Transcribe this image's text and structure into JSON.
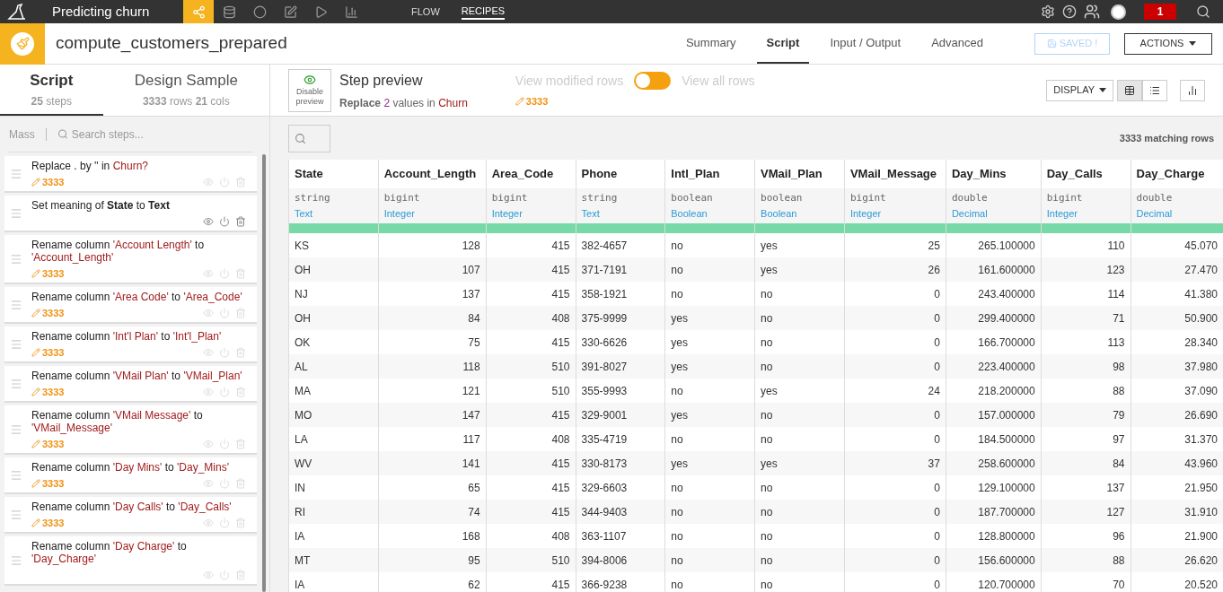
{
  "topbar": {
    "project": "Predicting churn",
    "nav_icons": [
      {
        "kind": "flow",
        "selected": true
      },
      {
        "kind": "datasets",
        "selected": false
      },
      {
        "kind": "recipes",
        "selected": false
      },
      {
        "kind": "notebooks",
        "selected": false
      },
      {
        "kind": "jobs",
        "selected": false
      },
      {
        "kind": "dashboards",
        "selected": false
      }
    ],
    "links": [
      {
        "label": "FLOW",
        "selected": false
      },
      {
        "label": "RECIPES",
        "selected": true
      }
    ],
    "notification_count": "1"
  },
  "recipe": {
    "name": "compute_customers_prepared",
    "tabs": [
      {
        "label": "Summary",
        "selected": false
      },
      {
        "label": "Script",
        "selected": true
      },
      {
        "label": "Input / Output",
        "selected": false
      },
      {
        "label": "Advanced",
        "selected": false
      }
    ],
    "saved_label": "SAVED !",
    "actions_label": "ACTIONS"
  },
  "left_tabs": [
    {
      "title": "Script",
      "selected": true,
      "sub": [
        {
          "text": "25",
          "bold": true
        },
        {
          "text": "steps",
          "bold": false
        }
      ]
    },
    {
      "title": "Design Sample",
      "selected": false,
      "sub": [
        {
          "text": "3333",
          "bold": true
        },
        {
          "text": "rows",
          "bold": false
        },
        {
          "text": "21",
          "bold": true
        },
        {
          "text": "cols",
          "bold": false
        }
      ]
    }
  ],
  "mass_label": "Mass",
  "search": {
    "placeholder": "Search steps..."
  },
  "steps": [
    {
      "parts": [
        {
          "t": "Replace . by '' in",
          "kind": "plain"
        },
        {
          "t": "Churn?",
          "kind": "column"
        }
      ],
      "count": "3333",
      "enabled": false
    },
    {
      "parts": [
        {
          "t": "Set meaning of",
          "kind": "plain"
        },
        {
          "t": "State",
          "kind": "bold"
        },
        {
          "t": "to",
          "kind": "plain"
        },
        {
          "t": "Text",
          "kind": "bold"
        }
      ],
      "enabled": true
    },
    {
      "parts": [
        {
          "t": "Rename column",
          "kind": "plain"
        },
        {
          "t": "'Account Length'",
          "kind": "column"
        },
        {
          "t": "to",
          "kind": "plain"
        },
        {
          "t": "'Account_Length'",
          "kind": "column"
        }
      ],
      "count": "3333",
      "enabled": false
    },
    {
      "parts": [
        {
          "t": "Rename column",
          "kind": "plain"
        },
        {
          "t": "'Area Code'",
          "kind": "column"
        },
        {
          "t": "to",
          "kind": "plain"
        },
        {
          "t": "'Area_Code'",
          "kind": "column"
        }
      ],
      "count": "3333",
      "enabled": false
    },
    {
      "parts": [
        {
          "t": "Rename column",
          "kind": "plain"
        },
        {
          "t": "'Int'l Plan'",
          "kind": "column"
        },
        {
          "t": "to",
          "kind": "plain"
        },
        {
          "t": "'Int'l_Plan'",
          "kind": "column"
        }
      ],
      "count": "3333",
      "enabled": false
    },
    {
      "parts": [
        {
          "t": "Rename column",
          "kind": "plain"
        },
        {
          "t": "'VMail Plan'",
          "kind": "column"
        },
        {
          "t": "to",
          "kind": "plain"
        },
        {
          "t": "'VMail_Plan'",
          "kind": "column"
        }
      ],
      "count": "3333",
      "enabled": false
    },
    {
      "parts": [
        {
          "t": "Rename column",
          "kind": "plain"
        },
        {
          "t": "'VMail Message'",
          "kind": "column"
        },
        {
          "t": "to",
          "kind": "plain"
        },
        {
          "t": "'VMail_Message'",
          "kind": "column"
        }
      ],
      "count": "3333",
      "enabled": false
    },
    {
      "parts": [
        {
          "t": "Rename column",
          "kind": "plain"
        },
        {
          "t": "'Day Mins'",
          "kind": "column"
        },
        {
          "t": "to",
          "kind": "plain"
        },
        {
          "t": "'Day_Mins'",
          "kind": "column"
        }
      ],
      "count": "3333",
      "enabled": false
    },
    {
      "parts": [
        {
          "t": "Rename column",
          "kind": "plain"
        },
        {
          "t": "'Day Calls'",
          "kind": "column"
        },
        {
          "t": "to",
          "kind": "plain"
        },
        {
          "t": "'Day_Calls'",
          "kind": "column"
        }
      ],
      "count": "3333",
      "enabled": false
    },
    {
      "parts": [
        {
          "t": "Rename column",
          "kind": "plain"
        },
        {
          "t": "'Day Charge'",
          "kind": "column"
        },
        {
          "t": "to",
          "kind": "plain"
        },
        {
          "t": "'Day_Charge'",
          "kind": "column"
        }
      ]
    }
  ],
  "preview": {
    "disable_label": "Disable preview",
    "title": "Step preview",
    "summary": [
      {
        "t": "Replace",
        "kind": "bold"
      },
      {
        "t": "2",
        "kind": "number"
      },
      {
        "t": "values in",
        "kind": "plain"
      },
      {
        "t": "Churn",
        "kind": "column"
      }
    ],
    "count": "3333",
    "view_modified": "View modified rows",
    "view_all": "View all rows",
    "show_all": false,
    "display_label": "DISPLAY",
    "views": [
      {
        "kind": "table",
        "selected": true
      },
      {
        "kind": "list",
        "selected": false
      }
    ]
  },
  "matching": "3333 matching rows",
  "table": {
    "columns": [
      {
        "name": "State",
        "storage": "string",
        "meaning": "Text",
        "kind": "text"
      },
      {
        "name": "Account_Length",
        "storage": "bigint",
        "meaning": "Integer",
        "kind": "number"
      },
      {
        "name": "Area_Code",
        "storage": "bigint",
        "meaning": "Integer",
        "kind": "number"
      },
      {
        "name": "Phone",
        "storage": "string",
        "meaning": "Text",
        "kind": "text"
      },
      {
        "name": "Intl_Plan",
        "storage": "boolean",
        "meaning": "Boolean",
        "kind": "text"
      },
      {
        "name": "VMail_Plan",
        "storage": "boolean",
        "meaning": "Boolean",
        "kind": "text"
      },
      {
        "name": "VMail_Message",
        "storage": "bigint",
        "meaning": "Integer",
        "kind": "number"
      },
      {
        "name": "Day_Mins",
        "storage": "double",
        "meaning": "Decimal",
        "kind": "number"
      },
      {
        "name": "Day_Calls",
        "storage": "bigint",
        "meaning": "Integer",
        "kind": "number"
      },
      {
        "name": "Day_Charge",
        "storage": "double",
        "meaning": "Decimal",
        "kind": "number"
      }
    ],
    "rows": [
      [
        "KS",
        "128",
        "415",
        "382-4657",
        "no",
        "yes",
        "25",
        "265.100000",
        "110",
        "45.070"
      ],
      [
        "OH",
        "107",
        "415",
        "371-7191",
        "no",
        "yes",
        "26",
        "161.600000",
        "123",
        "27.470"
      ],
      [
        "NJ",
        "137",
        "415",
        "358-1921",
        "no",
        "no",
        "0",
        "243.400000",
        "114",
        "41.380"
      ],
      [
        "OH",
        "84",
        "408",
        "375-9999",
        "yes",
        "no",
        "0",
        "299.400000",
        "71",
        "50.900"
      ],
      [
        "OK",
        "75",
        "415",
        "330-6626",
        "yes",
        "no",
        "0",
        "166.700000",
        "113",
        "28.340"
      ],
      [
        "AL",
        "118",
        "510",
        "391-8027",
        "yes",
        "no",
        "0",
        "223.400000",
        "98",
        "37.980"
      ],
      [
        "MA",
        "121",
        "510",
        "355-9993",
        "no",
        "yes",
        "24",
        "218.200000",
        "88",
        "37.090"
      ],
      [
        "MO",
        "147",
        "415",
        "329-9001",
        "yes",
        "no",
        "0",
        "157.000000",
        "79",
        "26.690"
      ],
      [
        "LA",
        "117",
        "408",
        "335-4719",
        "no",
        "no",
        "0",
        "184.500000",
        "97",
        "31.370"
      ],
      [
        "WV",
        "141",
        "415",
        "330-8173",
        "yes",
        "yes",
        "37",
        "258.600000",
        "84",
        "43.960"
      ],
      [
        "IN",
        "65",
        "415",
        "329-6603",
        "no",
        "no",
        "0",
        "129.100000",
        "137",
        "21.950"
      ],
      [
        "RI",
        "74",
        "415",
        "344-9403",
        "no",
        "no",
        "0",
        "187.700000",
        "127",
        "31.910"
      ],
      [
        "IA",
        "168",
        "408",
        "363-1107",
        "no",
        "no",
        "0",
        "128.800000",
        "96",
        "21.900"
      ],
      [
        "MT",
        "95",
        "510",
        "394-8006",
        "no",
        "no",
        "0",
        "156.600000",
        "88",
        "26.620"
      ],
      [
        "IA",
        "62",
        "415",
        "366-9238",
        "no",
        "no",
        "0",
        "120.700000",
        "70",
        "20.520"
      ]
    ]
  }
}
